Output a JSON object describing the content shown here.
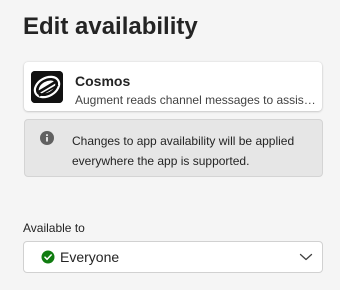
{
  "page": {
    "title": "Edit availability"
  },
  "app": {
    "name": "Cosmos",
    "description": "Augment reads channel messages to assist with questions and tasks",
    "logo_icon": "cosmos-logo-icon"
  },
  "notice": {
    "icon": "info-icon",
    "text": "Changes to app availability will be applied everywhere the app is supported."
  },
  "availability": {
    "label": "Available to",
    "selected": "Everyone",
    "selected_icon": "check-circle-icon",
    "selected_icon_color": "#107c10",
    "dropdown_icon": "chevron-down-icon"
  },
  "colors": {
    "background": "#f5f5f5",
    "card": "#ffffff",
    "notice_background": "#e6e6e6",
    "success": "#107c10"
  }
}
